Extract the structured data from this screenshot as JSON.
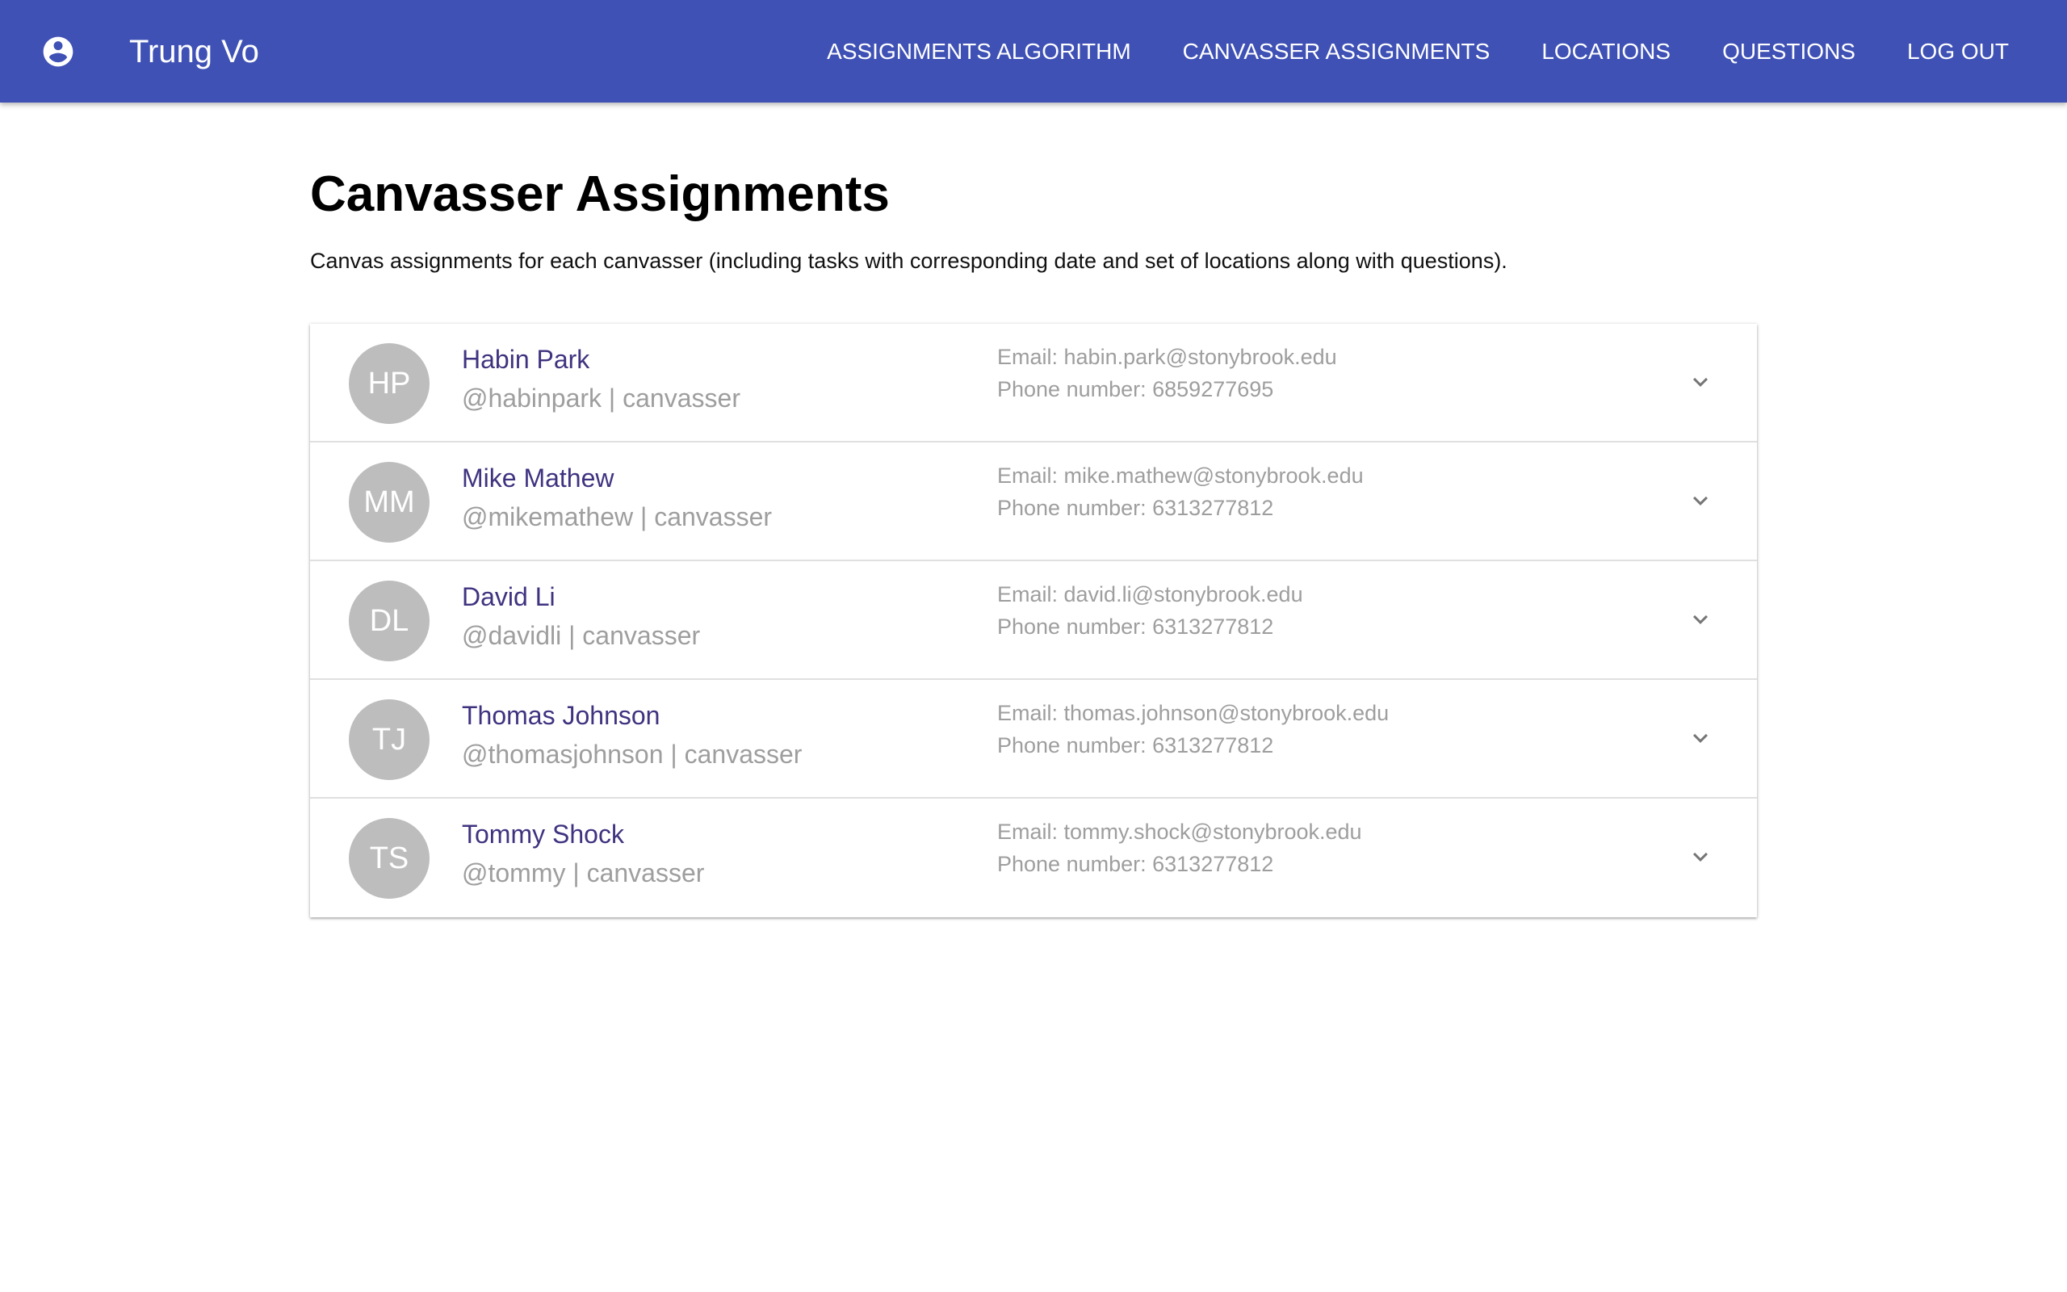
{
  "app": {
    "user_name": "Trung Vo",
    "account_icon": "account-circle-icon"
  },
  "nav": [
    {
      "label": "ASSIGNMENTS ALGORITHM"
    },
    {
      "label": "CANVASSER ASSIGNMENTS"
    },
    {
      "label": "LOCATIONS"
    },
    {
      "label": "QUESTIONS"
    },
    {
      "label": "LOG OUT"
    }
  ],
  "page": {
    "title": "Canvasser Assignments",
    "description": "Canvas assignments for each canvasser (including tasks with corresponding date and set of locations along with questions)."
  },
  "canvassers": [
    {
      "initials": "HP",
      "name": "Habin Park",
      "handle": "@habinpark | canvasser",
      "email": "Email: habin.park@stonybrook.edu",
      "phone": "Phone number: 6859277695"
    },
    {
      "initials": "MM",
      "name": "Mike Mathew",
      "handle": "@mikemathew | canvasser",
      "email": "Email: mike.mathew@stonybrook.edu",
      "phone": "Phone number: 6313277812"
    },
    {
      "initials": "DL",
      "name": "David Li",
      "handle": "@davidli | canvasser",
      "email": "Email: david.li@stonybrook.edu",
      "phone": "Phone number: 6313277812"
    },
    {
      "initials": "TJ",
      "name": "Thomas Johnson",
      "handle": "@thomasjohnson | canvasser",
      "email": "Email: thomas.johnson@stonybrook.edu",
      "phone": "Phone number: 6313277812"
    },
    {
      "initials": "TS",
      "name": "Tommy Shock",
      "handle": "@tommy | canvasser",
      "email": "Email: tommy.shock@stonybrook.edu",
      "phone": "Phone number: 6313277812"
    }
  ],
  "colors": {
    "appbar": "#3f51b5",
    "name_text": "#3f3380",
    "secondary_text": "#9e9e9e",
    "avatar": "#bdbdbd"
  }
}
